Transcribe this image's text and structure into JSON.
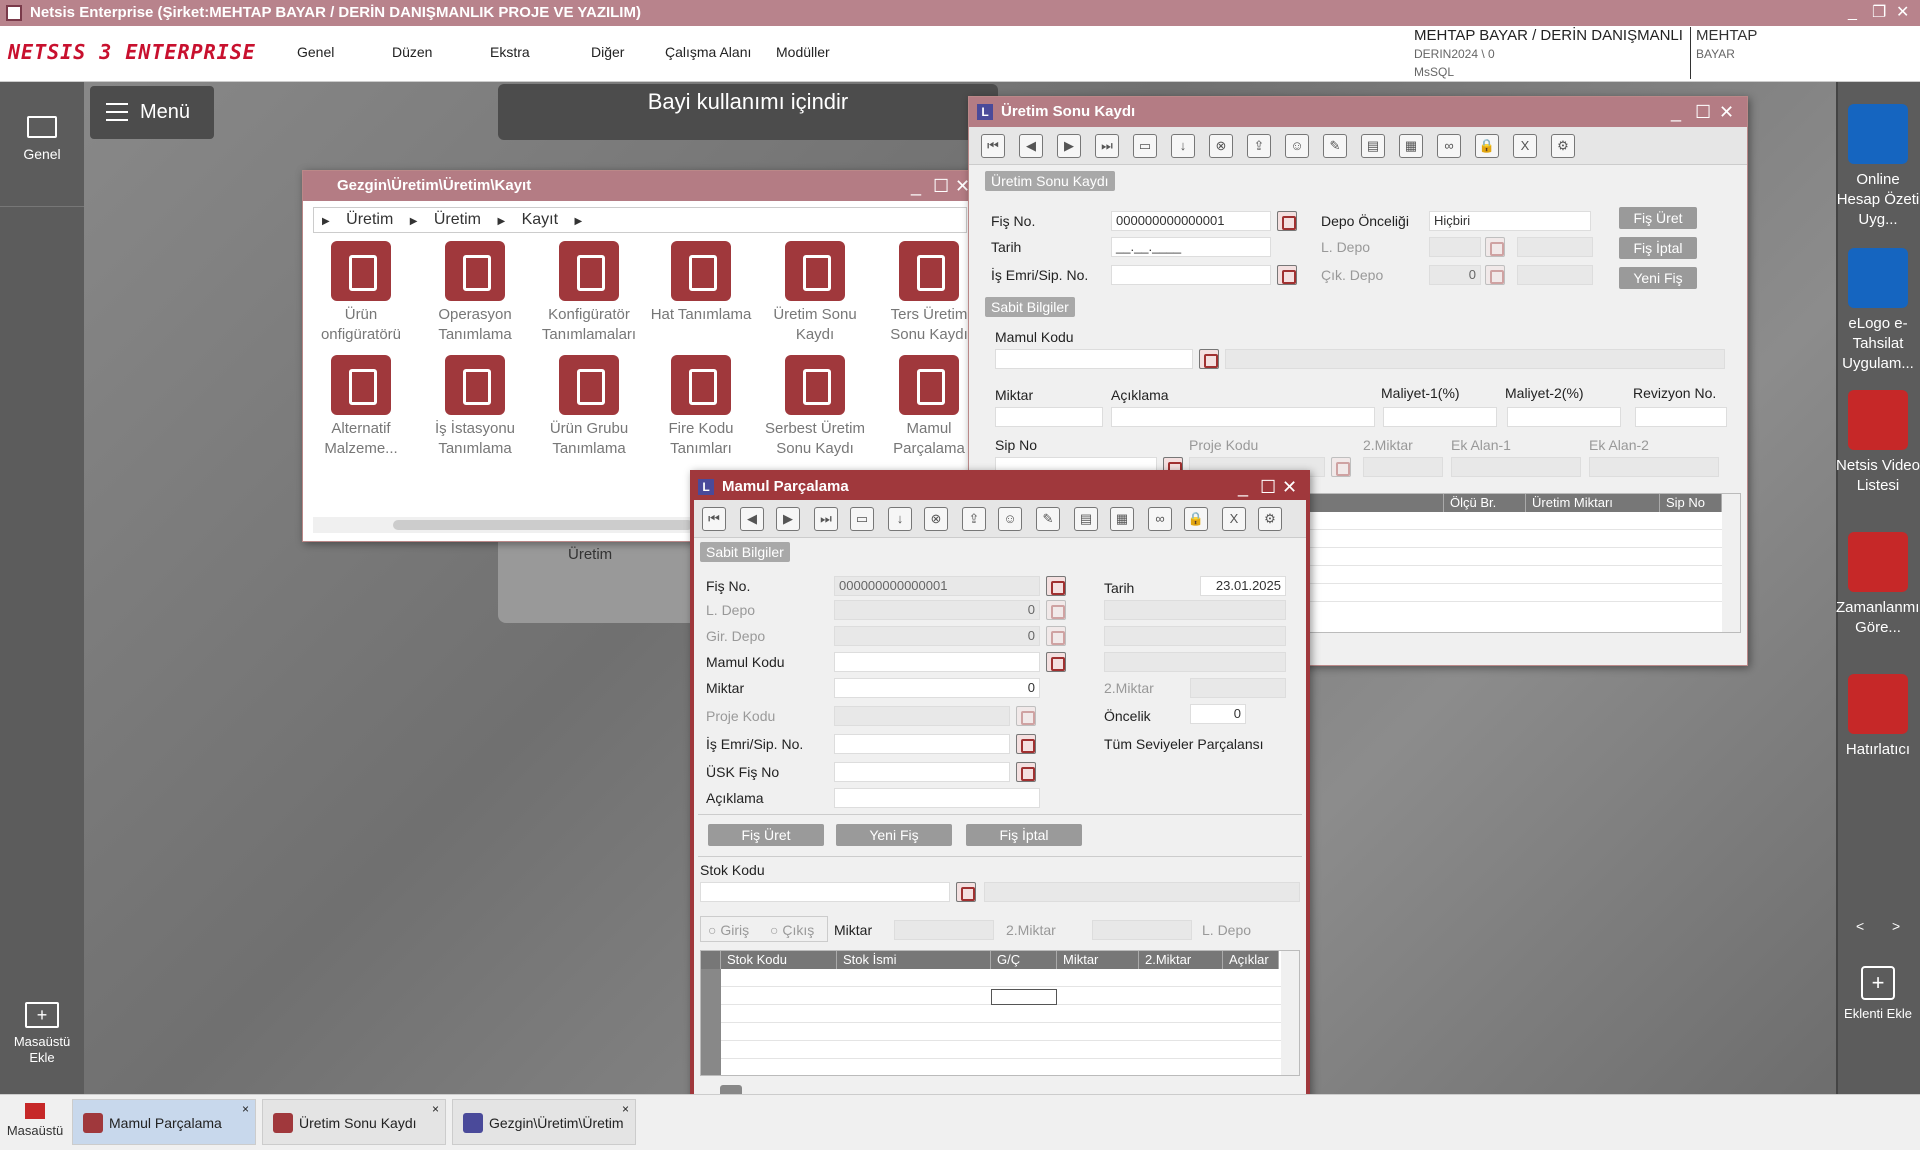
{
  "app": {
    "title": "Netsis Enterprise (Şirket:MEHTAP BAYAR / DERİN DANIŞMANLIK PROJE VE YAZILIM)",
    "logo": "NETSIS 3 ENTERPRISE"
  },
  "menu": [
    "Genel",
    "Düzen",
    "Ekstra",
    "Diğer",
    "Çalışma Alanı",
    "Modüller"
  ],
  "company": {
    "name": "MEHTAP BAYAR / DERİN DANIŞMANLI",
    "db": "DERIN2024 \\ 0",
    "engine": "MsSQL",
    "user": "MEHTAP",
    "user2": "BAYAR"
  },
  "left": {
    "genel": "Genel",
    "desktop_add": "Masaüstü Ekle"
  },
  "menu_button": "Menü",
  "banner": "Bayi kullanımı içindir",
  "bg_label": "Üretim",
  "right": {
    "apps": [
      "Online Hesap Özeti Uyg...",
      "eLogo e-Tahsilat Uygulam...",
      "Netsis Video Listesi",
      "Zamanlanmış Göre...",
      "Hatırlatıcı"
    ],
    "nav_prev": "<",
    "nav_next": ">",
    "addon": "Eklenti Ekle"
  },
  "gezgin": {
    "title": "Gezgin\\Üretim\\Üretim\\Kayıt",
    "crumbs": [
      "Üretim",
      "Üretim",
      "Kayıt"
    ],
    "tiles": [
      "Ürün onfigüratörü",
      "Operasyon Tanımlama",
      "Konfigüratör Tanımlamaları",
      "Hat Tanımlama",
      "Üretim Sonu Kaydı",
      "Ters Üretim Sonu Kaydı",
      "Alternatif Malzeme...",
      "İş İstasyonu Tanımlama",
      "Ürün Grubu Tanımlama",
      "Fire Kodu Tanımları",
      "Serbest Üretim Sonu Kaydı",
      "Mamul Parçalama"
    ]
  },
  "uretim": {
    "title": "Üretim Sonu Kaydı",
    "tag": "Üretim Sonu Kaydı",
    "fis_no_label": "Fiş No.",
    "fis_no": "000000000000001",
    "tarih_label": "Tarih",
    "tarih": "__.__.____",
    "isemri_label": "İş Emri/Sip. No.",
    "depo_onc_label": "Depo Önceliği",
    "depo_onc": "Hiçbiri",
    "ldepo_label": "L. Depo",
    "cikdepo_label": "Çık. Depo",
    "cikdepo": "0",
    "btn_uret": "Fiş Üret",
    "btn_iptal": "Fiş İptal",
    "btn_yeni": "Yeni Fiş",
    "sabit": "Sabit Bilgiler",
    "mamul_kodu": "Mamul Kodu",
    "miktar": "Miktar",
    "aciklama": "Açıklama",
    "maliyet1": "Maliyet-1(%)",
    "maliyet2": "Maliyet-2(%)",
    "revizyon": "Revizyon No.",
    "sip_no": "Sip No",
    "proje_kodu": "Proje Kodu",
    "miktar2": "2.Miktar",
    "ek1": "Ek Alan-1",
    "ek2": "Ek Alan-2",
    "cols": [
      "Ölçü Br.",
      "Üretim Miktarı",
      "Sip No"
    ]
  },
  "mamul": {
    "title": "Mamul Parçalama",
    "sabit": "Sabit Bilgiler",
    "fis_no_label": "Fiş No.",
    "fis_no": "000000000000001",
    "ldepo_label": "L. Depo",
    "ldepo": "0",
    "girdepo_label": "Gir. Depo",
    "girdepo": "0",
    "mamul_kodu": "Mamul Kodu",
    "miktar_label": "Miktar",
    "miktar": "0",
    "proje_kodu": "Proje Kodu",
    "isemri": "İş Emri/Sip. No.",
    "usk": "ÜSK Fiş No",
    "aciklama": "Açıklama",
    "tarih_label": "Tarih",
    "tarih": "23.01.2025",
    "miktar2": "2.Miktar",
    "oncelik_label": "Öncelik",
    "oncelik": "0",
    "tum": "Tüm Seviyeler Parçalansı",
    "btn_uret": "Fiş Üret",
    "btn_yeni": "Yeni Fiş",
    "btn_iptal": "Fiş İptal",
    "stok_kodu": "Stok Kodu",
    "giris": "Giriş",
    "cikis": "Çıkış",
    "f_miktar": "Miktar",
    "f_miktar2": "2.Miktar",
    "f_ldepo": "L. Depo",
    "cols": [
      "Stok Kodu",
      "Stok İsmi",
      "G/Ç",
      "Miktar",
      "2.Miktar",
      "Açıklar"
    ]
  },
  "taskbar": {
    "home": "Masaüstü",
    "tabs": [
      "Mamul Parçalama",
      "Üretim Sonu Kaydı",
      "Gezgin\\Üretim\\Üretim"
    ]
  }
}
